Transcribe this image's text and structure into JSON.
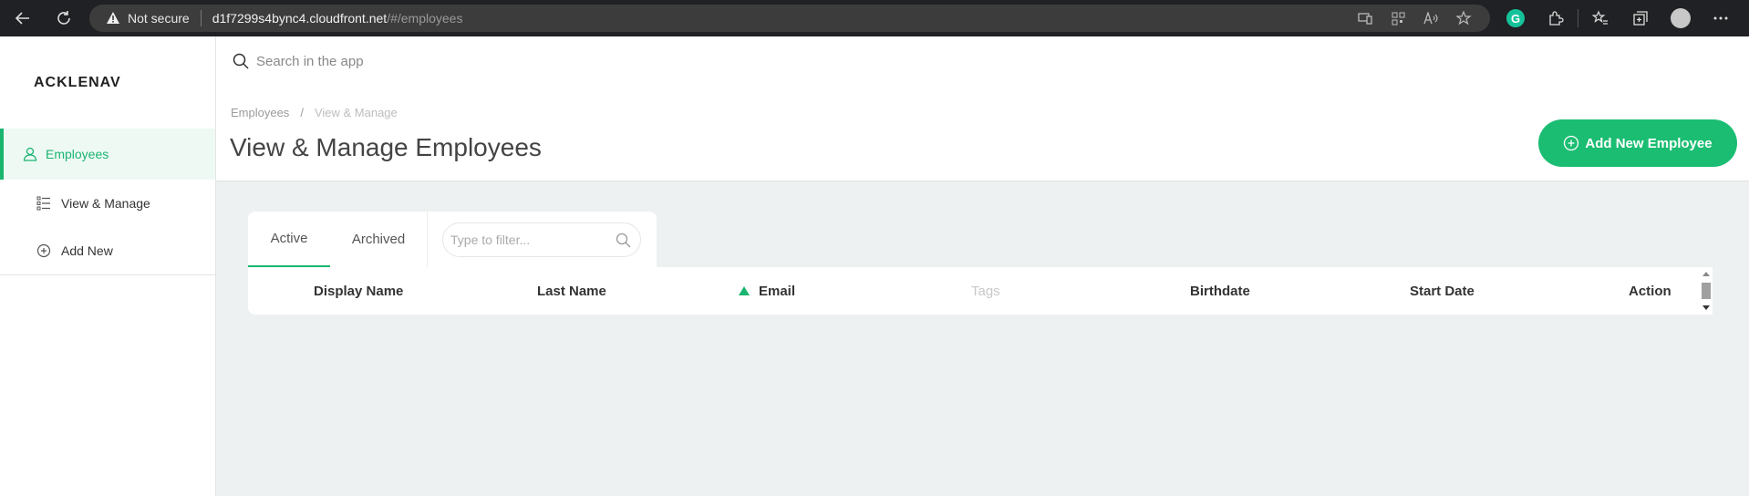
{
  "browser": {
    "not_secure": "Not secure",
    "host": "d1f7299s4bync4.cloudfront.net",
    "path": "/#/employees",
    "icons": [
      "back-icon",
      "refresh-icon",
      "warning-icon",
      "app-available-icon",
      "qr-icon",
      "read-aloud-icon",
      "favorite-icon",
      "grammarly-icon",
      "extensions-icon",
      "favorites-icon",
      "collections-icon",
      "profile-icon",
      "more-icon"
    ],
    "grammarly_letter": "G"
  },
  "sidebar": {
    "logo": "ACKLENAV",
    "items": [
      {
        "label": "Employees",
        "icon": "user-icon"
      },
      {
        "label": "View & Manage",
        "icon": "list-icon"
      },
      {
        "label": "Add New",
        "icon": "plus-circle-icon"
      }
    ]
  },
  "header": {
    "search_placeholder": "Search in the app",
    "breadcrumb": [
      "Employees",
      "View & Manage"
    ],
    "breadcrumb_sep": "/",
    "title": "View & Manage Employees",
    "add_button": "Add New Employee"
  },
  "tabs": [
    {
      "label": "Active",
      "active": true
    },
    {
      "label": "Archived",
      "active": false
    }
  ],
  "filter": {
    "placeholder": "Type to filter..."
  },
  "table": {
    "columns": [
      "Display Name",
      "Last Name",
      "Email",
      "Tags",
      "Birthdate",
      "Start Date",
      "Action"
    ],
    "sorted_column": "Email",
    "sort_direction": "ascending"
  },
  "colors": {
    "accent": "#1ab56f",
    "button": "#1bbd72",
    "content_bg": "#eef1f2",
    "chrome": "#202124"
  }
}
